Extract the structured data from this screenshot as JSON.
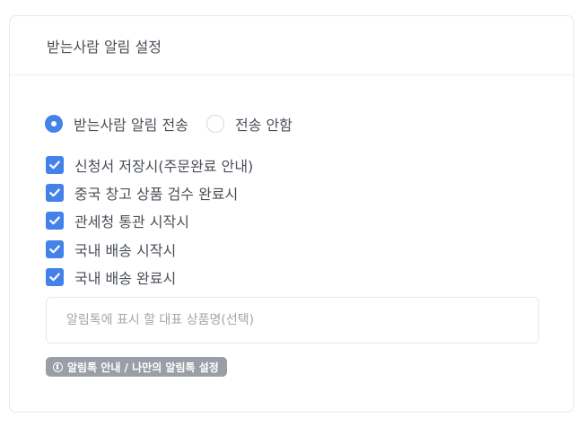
{
  "card": {
    "title": "받는사람 알림 설정"
  },
  "send_option": {
    "options": [
      {
        "label": "받는사람 알림 전송",
        "selected": true
      },
      {
        "label": "전송 안함",
        "selected": false
      }
    ]
  },
  "notify_events": [
    {
      "label": "신청서 저장시(주문완료 안내)",
      "checked": true
    },
    {
      "label": "중국 창고 상품 검수 완료시",
      "checked": true
    },
    {
      "label": "관세청 통관 시작시",
      "checked": true
    },
    {
      "label": "국내 배송 시작시",
      "checked": true
    },
    {
      "label": "국내 배송 완료시",
      "checked": true
    }
  ],
  "product_name": {
    "value": "",
    "placeholder": "알림톡에 표시 할 대표 상품명(선택)"
  },
  "guide_link": {
    "label": "알림톡 안내 / 나만의 알림톡 설정",
    "icon": "info-icon"
  },
  "colors": {
    "accent": "#4382e8",
    "badge": "#9a9ea6",
    "border": "#e6e8eb",
    "text": "#4a4f57"
  }
}
